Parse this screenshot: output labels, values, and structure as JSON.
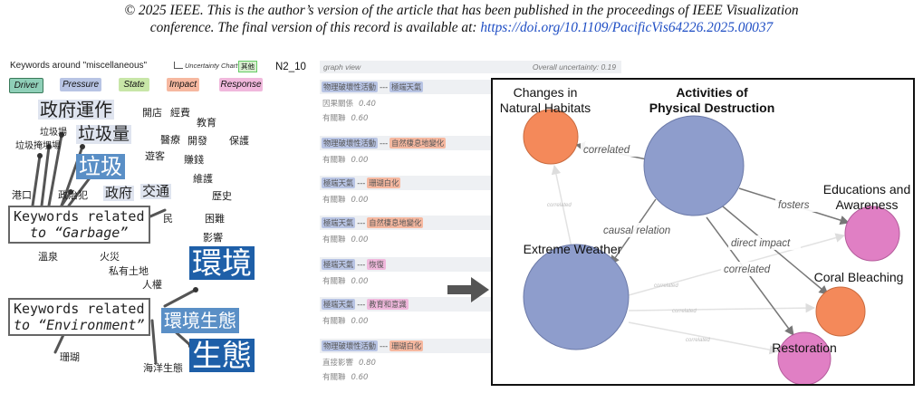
{
  "copyright": {
    "line1": "© 2025 IEEE. This is the author’s version of the article that has been published in the proceedings of IEEE Visualization",
    "line2_prefix": "conference. The final version of this record is available at: ",
    "line2_link": "https://doi.org/10.1109/PacificVis64226.2025.00037"
  },
  "left_panel": {
    "title": "Keywords around \"miscellaneous\"",
    "uncertainty_chart": "Uncertainty Chart",
    "other_button": "其他",
    "legend": [
      {
        "label": "Driver",
        "color": "#8fcfb8",
        "border": "#3a7a5a"
      },
      {
        "label": "Pressure",
        "color": "#b8c4e4",
        "border": "#b8c4e4"
      },
      {
        "label": "State",
        "color": "#c8e6a8",
        "border": "#c8e6a8"
      },
      {
        "label": "Impact",
        "color": "#f6b8a0",
        "border": "#f6b8a0"
      },
      {
        "label": "Response",
        "color": "#f0b8dc",
        "border": "#f0b8dc"
      }
    ],
    "keywords": [
      "政府運作",
      "開店",
      "經費",
      "教育",
      "垃圾場",
      "垃圾量",
      "醫療",
      "開發",
      "保護",
      "垃圾掩埋場",
      "遊客",
      "賺錢",
      "垃圾",
      "維護",
      "港口",
      "政治犯",
      "政府",
      "交通",
      "歷史",
      "民",
      "困難",
      "影響",
      "溫泉",
      "火災",
      "私有土地",
      "人權",
      "環境",
      "環境生態",
      "珊瑚",
      "海洋生態",
      "生態"
    ],
    "callouts": {
      "garbage_prefix": "Keywords related",
      "garbage_suffix": "to “Garbage”",
      "env_prefix": "Keywords related",
      "env_suffix": "to “Environment”"
    },
    "accent_dark": "#1e5fa8",
    "accent_mid": "#5a8fc6"
  },
  "middle_panel": {
    "label": "N2_10",
    "graph_view": "graph view",
    "overall_uncertainty": "Overall uncertainty: 0.19",
    "relations": [
      {
        "a": "物理破壞性活動",
        "a_color": "#b8c4e4",
        "b": "極端天氣",
        "b_color": "#b8c4e4",
        "lines": [
          {
            "text": "因果關係",
            "num": "0.40"
          },
          {
            "text": "有關聯",
            "num": "0.60"
          }
        ]
      },
      {
        "a": "物理破壞性活動",
        "a_color": "#b8c4e4",
        "b": "自然棲息地變化",
        "b_color": "#f6b8a0",
        "lines": [
          {
            "text": "有關聯",
            "num": "0.00"
          }
        ]
      },
      {
        "a": "極端天氣",
        "a_color": "#b8c4e4",
        "b": "珊瑚白化",
        "b_color": "#f6b8a0",
        "lines": [
          {
            "text": "有關聯",
            "num": "0.00"
          }
        ]
      },
      {
        "a": "極端天氣",
        "a_color": "#b8c4e4",
        "b": "自然棲息地變化",
        "b_color": "#f6b8a0",
        "lines": [
          {
            "text": "有關聯",
            "num": "0.00"
          }
        ]
      },
      {
        "a": "極端天氣",
        "a_color": "#b8c4e4",
        "b": "恢復",
        "b_color": "#f0b8dc",
        "lines": [
          {
            "text": "有關聯",
            "num": "0.00"
          }
        ]
      },
      {
        "a": "極端天氣",
        "a_color": "#b8c4e4",
        "b": "教育和意識",
        "b_color": "#f0b8dc",
        "lines": [
          {
            "text": "有關聯",
            "num": "0.00"
          }
        ]
      },
      {
        "a": "物理破壞性活動",
        "a_color": "#b8c4e4",
        "b": "珊瑚白化",
        "b_color": "#f6b8a0",
        "lines": [
          {
            "text": "直接影響",
            "num": "0.80"
          },
          {
            "text": "有關聯",
            "num": "0.60"
          }
        ]
      }
    ]
  },
  "graph": {
    "nodes": {
      "natural_habitats": {
        "label1": "Changes in",
        "label2": "Natural Habitats",
        "color": "#f4895a"
      },
      "physical_destruction": {
        "label1": "Activities of",
        "label2": "Physical Destruction",
        "color": "#8e9dcc"
      },
      "extreme_weather": {
        "label1": "Extreme Weather",
        "color": "#8e9dcc"
      },
      "education": {
        "label1": "Educations and",
        "label2": "Awareness",
        "color": "#e07fc4"
      },
      "coral_bleaching": {
        "label1": "Coral Bleaching",
        "color": "#f4895a"
      },
      "restoration": {
        "label1": "Restoration",
        "color": "#e07fc4"
      }
    },
    "edges": {
      "correlated": "correlated",
      "causal": "causal relation",
      "fosters": "fosters",
      "direct_impact": "direct impact",
      "correlated2": "correlated",
      "faint": "correlated"
    }
  }
}
